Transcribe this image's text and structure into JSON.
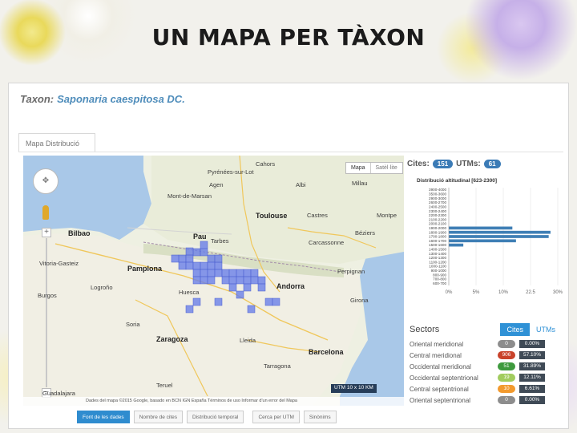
{
  "slide": {
    "title": "UN MAPA PER TÀXON"
  },
  "taxon": {
    "label": "Taxon:",
    "name": "Saponaria caespitosa DC."
  },
  "tabs": {
    "active": "Mapa Distribució"
  },
  "map": {
    "type_buttons": [
      "Mapa",
      "Satèl·lite"
    ],
    "labels": {
      "cahors": "Cahors",
      "pyrenees_sur": "Pyrénées-sur-Lot",
      "agen": "Agen",
      "albi": "Albi",
      "millau": "Millau",
      "mont_marsan": "Mont-de-Marsan",
      "toulouse": "Toulouse",
      "castres": "Castres",
      "montpe": "Montpe",
      "bilbao": "Bilbao",
      "pau": "Pau",
      "tarbes": "Tarbes",
      "carcassonne": "Carcassonne",
      "beziers": "Béziers",
      "vitoria": "Vitoria-Gasteiz",
      "pamplona": "Pamplona",
      "perpignan": "Perpignan",
      "andorra": "Andorra",
      "logrono": "Logroño",
      "zaragoza": "Zaragoza",
      "lleida": "Lleida",
      "barcelona": "Barcelona",
      "tarragona": "Tarragona",
      "teruel": "Teruel",
      "guadalajara": "Guadalajara",
      "burgos": "Burgos",
      "soria": "Soria",
      "huesca": "Huesca",
      "girona": "Girona"
    },
    "attribution": "Dades del mapa ©2015 Google, basado en BCN IGN España  Términos de uso  Informar d'un error del Mapa",
    "utm_badge": "UTM  10 x 10 KM"
  },
  "counts": {
    "citas_label": "Cites:",
    "citas": "151",
    "utms_label": "UTMs:",
    "utms": "61"
  },
  "chart_data": {
    "type": "bar",
    "orientation": "horizontal",
    "title": "Distribució altitudinal [623-2300]",
    "categories": [
      "3900-4000",
      "3500-3600",
      "2900-3000",
      "2600-2700",
      "2400-2500",
      "2300-2400",
      "2200-2300",
      "2100-2200",
      "2000-2100",
      "1900-2000",
      "1800-1900",
      "1700-1800",
      "1600-1700",
      "1500-1600",
      "1400-1500",
      "1300-1400",
      "1200-1300",
      "1100-1200",
      "1000-1100",
      "900-1000",
      "800-900",
      "700-800",
      "600-700"
    ],
    "values": [
      0,
      0,
      0,
      0,
      0,
      0,
      0,
      0,
      0,
      17.5,
      28,
      27.5,
      18.5,
      4,
      0,
      0,
      0,
      0,
      0,
      0,
      0,
      0,
      0
    ],
    "xlim": [
      0,
      30
    ],
    "xticks": [
      "0%",
      "5%",
      "10%",
      "22.5",
      "30%"
    ]
  },
  "sectors": {
    "title": "Sectors",
    "toggle": [
      "Cites",
      "UTMs"
    ],
    "rows": [
      {
        "name": "Oriental meridional",
        "count": "0",
        "pct": "0.00%",
        "color": "#8d8d8d"
      },
      {
        "name": "Central meridional",
        "count": "906",
        "pct": "57.10%",
        "color": "#c9432b"
      },
      {
        "name": "Occidental meridional",
        "count": "51",
        "pct": "31.89%",
        "color": "#3e9a3e"
      },
      {
        "name": "Occidental septentrional",
        "count": "19",
        "pct": "12.11%",
        "color": "#a1cc5e"
      },
      {
        "name": "Central septentrional",
        "count": "10",
        "pct": "6.61%",
        "color": "#f29a2e"
      },
      {
        "name": "Oriental septentrional",
        "count": "0",
        "pct": "0.00%",
        "color": "#8d8d8d"
      }
    ]
  },
  "bottom_tabs": [
    "Font de les dades",
    "Nombre de cites",
    "Distribució temporal",
    "Cerca per UTM",
    "Sinònims"
  ]
}
